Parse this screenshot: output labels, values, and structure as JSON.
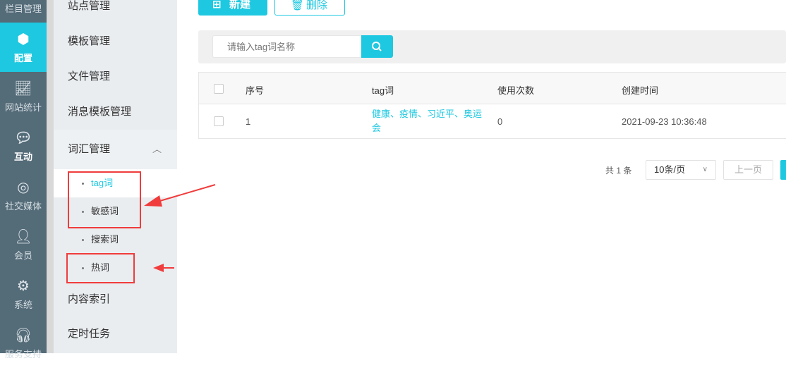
{
  "rail": [
    {
      "label": "栏目管理",
      "icon": "columns-icon"
    },
    {
      "label": "配置",
      "icon": "cube-icon",
      "active": true
    },
    {
      "label": "网站统计",
      "icon": "line-chart-icon"
    },
    {
      "label": "互动",
      "icon": "chat-icon"
    },
    {
      "label": "社交媒体",
      "icon": "target-icon"
    },
    {
      "label": "会员",
      "icon": "user-icon"
    },
    {
      "label": "系统",
      "icon": "gear-icon"
    },
    {
      "label": "服务支持",
      "icon": "headset-icon"
    }
  ],
  "sidebar": {
    "items": [
      "站点管理",
      "模板管理",
      "文件管理",
      "消息模板管理"
    ],
    "group": "词汇管理",
    "sub": [
      "tag词",
      "敏感词",
      "搜索词",
      "热词"
    ],
    "after": [
      "内容索引",
      "定时任务"
    ]
  },
  "toolbar": {
    "new": "新建",
    "delete": "删除"
  },
  "search": {
    "placeholder": "请输入tag词名称"
  },
  "table": {
    "headers": [
      "序号",
      "tag词",
      "使用次数",
      "创建时间"
    ],
    "rows": [
      {
        "index": "1",
        "tags": "健康、疫情、习近平、奥运会",
        "count": "0",
        "created": "2021-09-23 10:36:48"
      }
    ]
  },
  "pagination": {
    "total": "共 1 条",
    "page_size": "10条/页",
    "prev": "上一页"
  },
  "colors": {
    "accent": "#1ec8e0",
    "rail": "#546b78",
    "annotation": "#f03c3c"
  }
}
